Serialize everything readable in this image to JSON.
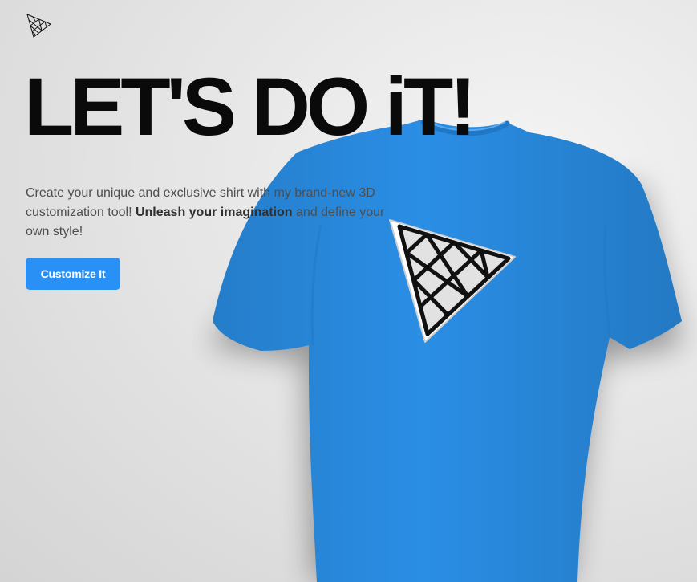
{
  "brand": {
    "logo_icon": "triangle-mesh-logo-icon"
  },
  "hero": {
    "headline": "LET'S DO iT!",
    "description_part1": "Create your unique and exclusive shirt with my brand-new 3D customization tool!",
    "description_emphasis": "Unleash your imagination",
    "description_part2": "and define your own style!",
    "cta_label": "Customize It"
  },
  "product": {
    "shirt_color": "#2a8ee5",
    "decal_icon": "triangle-mesh-decal-icon"
  },
  "colors": {
    "accent": "#2991f5",
    "headline": "#0a0a0a",
    "body_text": "#4e4e4e"
  }
}
